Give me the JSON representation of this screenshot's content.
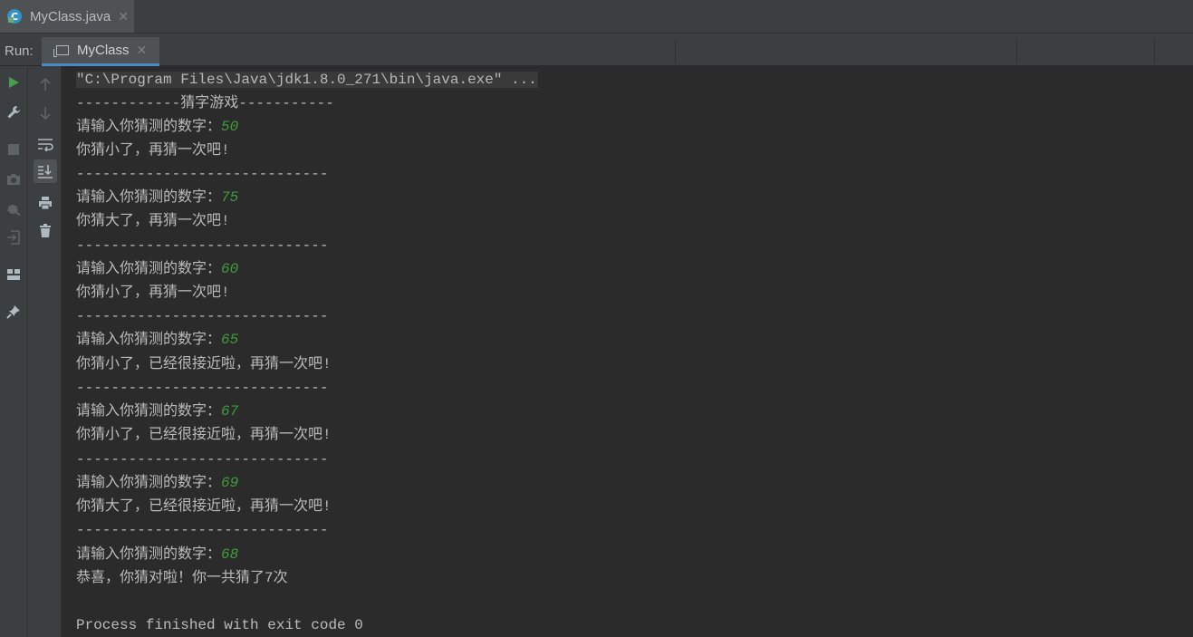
{
  "editor": {
    "tabs": [
      {
        "label": "MyClass.java",
        "icon": "java-class-icon"
      }
    ]
  },
  "run_panel": {
    "run_label": "Run:",
    "tab_label": "MyClass"
  },
  "colors": {
    "input_number": "#3e9d3e",
    "text": "#bbbbbb",
    "active_tab_underline": "#4a88c7",
    "run_icon": "#499c54"
  },
  "toolbar": {
    "outer": [
      "run-icon",
      "wrench-icon",
      "stop-icon",
      "camera-icon",
      "debug-icon",
      "exit-icon",
      "layout-icon",
      "pin-icon"
    ],
    "inner": [
      "arrow-up-icon",
      "arrow-down-icon",
      "soft-wrap-icon",
      "scroll-to-end-icon",
      "print-icon",
      "trash-icon"
    ]
  },
  "console": {
    "command": "\"C:\\Program Files\\Java\\jdk1.8.0_271\\bin\\java.exe\" ...",
    "header": "------------猜字游戏-----------",
    "prompt": "请输入你猜测的数字：",
    "separator": "-----------------------------",
    "guesses": [
      {
        "number": "50",
        "reply": "你猜小了，再猜一次吧!"
      },
      {
        "number": "75",
        "reply": "你猜大了，再猜一次吧!"
      },
      {
        "number": "60",
        "reply": "你猜小了，再猜一次吧!"
      },
      {
        "number": "65",
        "reply": "你猜小了，已经很接近啦，再猜一次吧!"
      },
      {
        "number": "67",
        "reply": "你猜小了，已经很接近啦，再猜一次吧!"
      },
      {
        "number": "69",
        "reply": "你猜大了，已经很接近啦，再猜一次吧!"
      },
      {
        "number": "68",
        "reply": "恭喜，你猜对啦！你一共猜了7次"
      }
    ],
    "exit_message": "Process finished with exit code 0"
  }
}
